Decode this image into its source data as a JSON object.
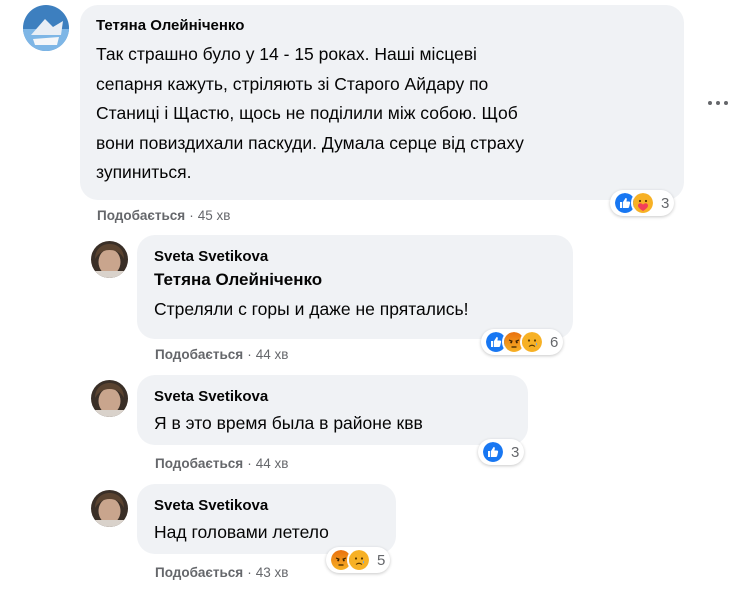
{
  "comments": [
    {
      "author": "Тетяна Олейніченко",
      "lines": [
        "Так страшно було у 14 - 15 роках. Наші місцеві",
        "сепарня кажуть, стріляють зі Старого Айдару по",
        "Станиці і Щастю, щось не поділили між собою. Щоб",
        "вони повиздихали паскуди. Думала серце від страху",
        "зупиниться."
      ],
      "like_label": "Подобається",
      "time": "45 хв",
      "reaction_icons": [
        "like-icon",
        "care-icon"
      ],
      "reaction_count": "3"
    },
    {
      "author": "Sveta Svetikova",
      "mention": "Тетяна Олейніченко",
      "text": "Стреляли с горы и даже не прятались!",
      "like_label": "Подобається",
      "time": "44 хв",
      "reaction_icons": [
        "like-icon",
        "angry-icon",
        "sad-icon"
      ],
      "reaction_count": "6"
    },
    {
      "author": "Sveta Svetikova",
      "text": "Я в это время была в районе квв",
      "like_label": "Подобається",
      "time": "44 хв",
      "reaction_icons": [
        "like-icon"
      ],
      "reaction_count": "3"
    },
    {
      "author": "Sveta Svetikova",
      "text": "Над головами летело",
      "like_label": "Подобається",
      "time": "43 хв",
      "reaction_icons": [
        "angry-icon",
        "sad-icon"
      ],
      "reaction_count": "5"
    }
  ],
  "colors": {
    "bubble": "#f0f2f5",
    "meta_text": "#65676b",
    "like_blue": "#1877f2",
    "angry_orange": "#e9710f",
    "sad_yellow": "#f7b125"
  }
}
